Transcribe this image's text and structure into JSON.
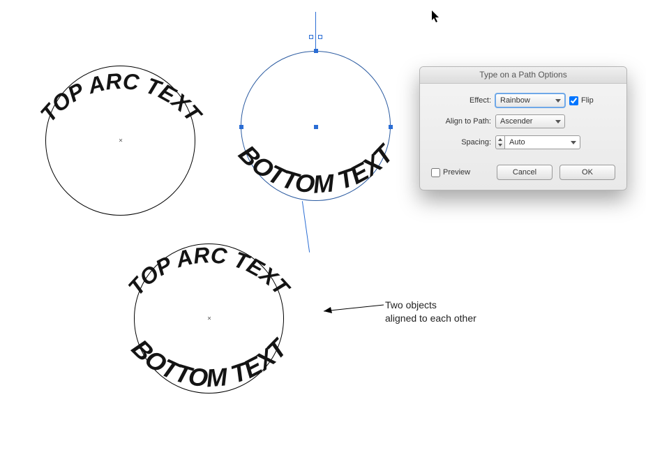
{
  "arcs": {
    "top1": "TOP ARC TEXT",
    "bottom2": "BOTTOM TEXT",
    "top3": "TOP ARC TEXT",
    "bottom3": "BOTTOM TEXT"
  },
  "dialog": {
    "title": "Type on a Path Options",
    "labels": {
      "effect": "Effect:",
      "align": "Align to Path:",
      "spacing": "Spacing:",
      "flip": "Flip",
      "preview": "Preview"
    },
    "values": {
      "effect": "Rainbow",
      "align": "Ascender",
      "spacing": "Auto",
      "flip_checked": true,
      "preview_checked": false
    },
    "buttons": {
      "cancel": "Cancel",
      "ok": "OK"
    }
  },
  "annotation": {
    "line1": "Two objects",
    "line2": "aligned to each other"
  }
}
